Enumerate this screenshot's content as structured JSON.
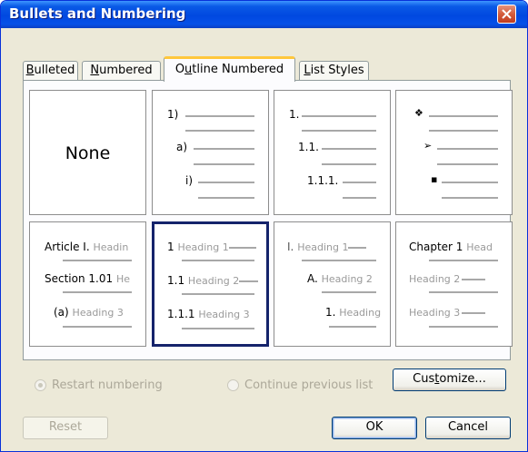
{
  "window": {
    "title": "Bullets and Numbering"
  },
  "tabs": [
    {
      "pre": "",
      "accel": "B",
      "post": "ulleted"
    },
    {
      "pre": "",
      "accel": "N",
      "post": "umbered"
    },
    {
      "pre": "O",
      "accel": "u",
      "post": "tline Numbered"
    },
    {
      "pre": "",
      "accel": "L",
      "post": "ist Styles"
    }
  ],
  "gallery": {
    "none_label": "None",
    "cell2": {
      "l1": "1)",
      "l2": "a)",
      "l3": "i)"
    },
    "cell3": {
      "l1": "1.",
      "l2": "1.1.",
      "l3": "1.1.1."
    },
    "cell4": {
      "l1": "❖",
      "l2": "➢",
      "l3": "▪"
    },
    "cell5": {
      "n1": "Article I.",
      "h1": "Headin",
      "n2": "Section 1.01",
      "h2": "He",
      "n3": "(a)",
      "h3": "Heading 3"
    },
    "cell6": {
      "n1": "1",
      "h1": "Heading 1",
      "n2": "1.1",
      "h2": "Heading 2",
      "n3": "1.1.1",
      "h3": "Heading 3"
    },
    "cell7": {
      "n1": "I.",
      "h1": "Heading 1",
      "n2": "A.",
      "h2": "Heading 2",
      "n3": "1.",
      "h3": "Heading"
    },
    "cell8": {
      "n1": "Chapter 1",
      "h1": "Head",
      "h2": "Heading 2",
      "h3": "Heading 3"
    }
  },
  "options": {
    "restart": "Restart numbering",
    "continue": "Continue previous list"
  },
  "buttons": {
    "customize_pre": "Cus",
    "customize_accel": "t",
    "customize_post": "omize...",
    "reset": "Reset",
    "ok": "OK",
    "cancel": "Cancel"
  }
}
